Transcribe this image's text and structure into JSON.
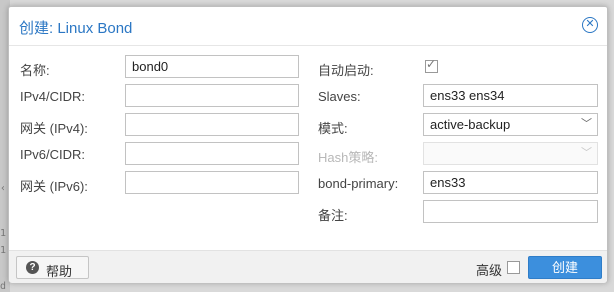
{
  "dialog": {
    "title": "创建: Linux Bond",
    "close_icon": "close-icon"
  },
  "left_fields": {
    "name_label": "名称:",
    "name_value": "bond0",
    "ipv4_label": "IPv4/CIDR:",
    "ipv4_value": "",
    "gateway4_label": "网关 (IPv4):",
    "gateway4_value": "",
    "ipv6_label": "IPv6/CIDR:",
    "ipv6_value": "",
    "gateway6_label": "网关 (IPv6):",
    "gateway6_value": ""
  },
  "right_fields": {
    "autostart_label": "自动启动:",
    "autostart_checked": true,
    "slaves_label": "Slaves:",
    "slaves_value": "ens33 ens34",
    "mode_label": "模式:",
    "mode_value": "active-backup",
    "hash_label": "Hash策略:",
    "hash_value": "",
    "bond_primary_label": "bond-primary:",
    "bond_primary_value": "ens33",
    "comment_label": "备注:",
    "comment_value": ""
  },
  "footer": {
    "help_label": "帮助",
    "help_icon": "question-circle-icon",
    "advanced_label": "高级",
    "advanced_checked": false,
    "create_label": "创建"
  },
  "colors": {
    "accent": "#2b77c4",
    "primary_button": "#3c8fdd"
  }
}
